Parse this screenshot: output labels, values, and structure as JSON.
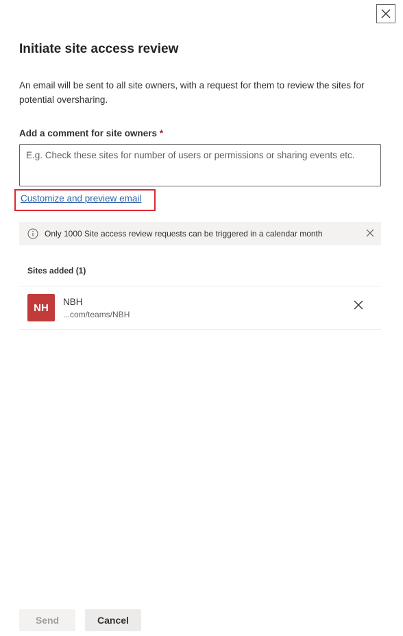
{
  "panel": {
    "title": "Initiate site access review",
    "description": "An email will be sent to all site owners, with a request for them to review the sites for potential oversharing."
  },
  "comment": {
    "label": "Add a comment for site owners",
    "required_marker": "*",
    "placeholder": "E.g. Check these sites for number of users or permissions or sharing events etc.",
    "value": ""
  },
  "preview_link": "Customize and preview email",
  "info_bar": {
    "text": "Only 1000 Site access review requests can be triggered in a calendar month"
  },
  "sites": {
    "header": "Sites added (1)",
    "items": [
      {
        "initials": "NH",
        "name": "NBH",
        "url": "...com/teams/NBH",
        "avatar_color": "#c23b3b"
      }
    ]
  },
  "footer": {
    "send_label": "Send",
    "cancel_label": "Cancel"
  },
  "colors": {
    "highlight_border": "#d92832",
    "link": "#3164a8",
    "required": "#a4262c"
  }
}
